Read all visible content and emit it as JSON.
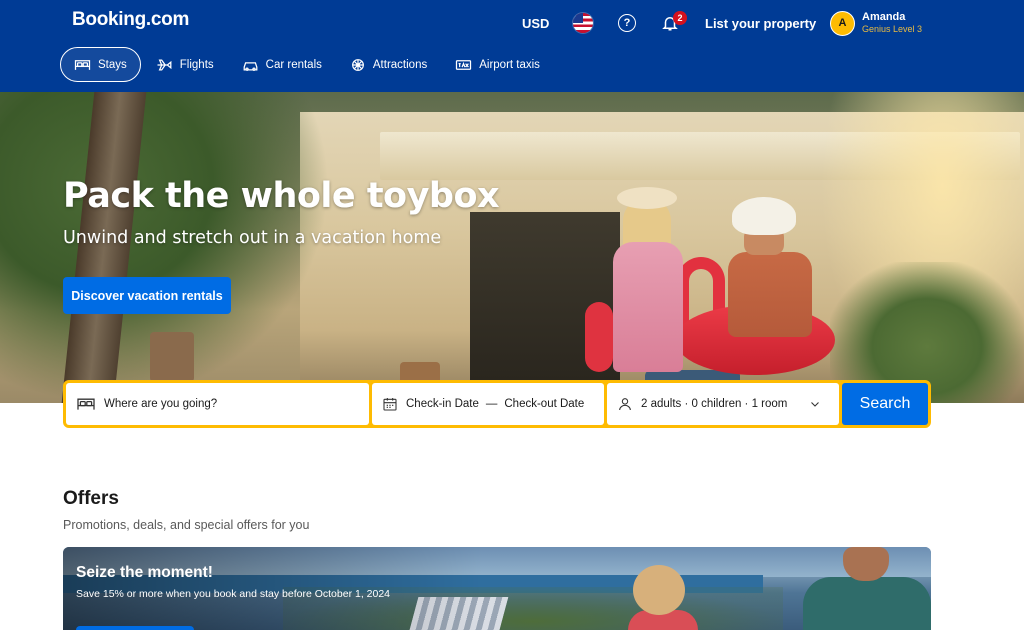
{
  "header": {
    "logo": "Booking.com",
    "currency": "USD",
    "notifications_count": "2",
    "list_property": "List your property",
    "user": {
      "avatar_initial": "A",
      "name": "Amanda",
      "level": "Genius Level 3"
    }
  },
  "nav": {
    "items": [
      {
        "label": "Stays",
        "icon": "bed-icon",
        "active": true
      },
      {
        "label": "Flights",
        "icon": "plane-icon",
        "active": false
      },
      {
        "label": "Car rentals",
        "icon": "car-icon",
        "active": false
      },
      {
        "label": "Attractions",
        "icon": "attractions-icon",
        "active": false
      },
      {
        "label": "Airport taxis",
        "icon": "taxi-icon",
        "active": false
      }
    ]
  },
  "hero": {
    "title": "Pack the whole toybox",
    "subtitle": "Unwind and stretch out in a vacation home",
    "button": "Discover vacation rentals"
  },
  "search": {
    "destination_placeholder": "Where are you going?",
    "checkin": "Check-in Date",
    "separator": "—",
    "checkout": "Check-out Date",
    "guests": "2 adults · 0 children · 1 room",
    "button": "Search"
  },
  "offers": {
    "title": "Offers",
    "subtitle": "Promotions, deals, and special offers for you",
    "promo": {
      "title": "Seize the moment!",
      "text": "Save 15% or more when you book and stay before October 1, 2024"
    }
  },
  "colors": {
    "brand_blue": "#003b95",
    "action_blue": "#006ce4",
    "search_border": "#febb02"
  }
}
